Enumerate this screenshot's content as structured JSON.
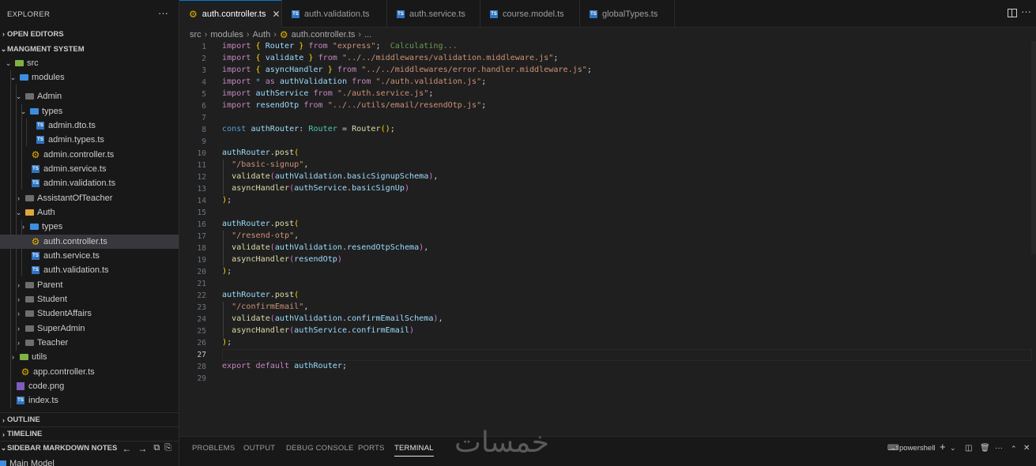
{
  "explorer": {
    "title": "EXPLORER",
    "more": "···",
    "open_editors": "OPEN EDITORS",
    "project": "MANGMENT SYSTEM",
    "outline": "OUTLINE",
    "timeline": "TIMELINE",
    "markdown_notes": "SIDEBAR MARKDOWN NOTES",
    "markdown_item": "Main Model",
    "tree": [
      {
        "label": "src"
      },
      {
        "label": "modules"
      },
      {
        "label": "Admin"
      },
      {
        "label": "types"
      },
      {
        "label": "admin.dto.ts"
      },
      {
        "label": "admin.types.ts"
      },
      {
        "label": "admin.controller.ts"
      },
      {
        "label": "admin.service.ts"
      },
      {
        "label": "admin.validation.ts"
      },
      {
        "label": "AssistantOfTeacher"
      },
      {
        "label": "Auth"
      },
      {
        "label": "types"
      },
      {
        "label": "auth.controller.ts"
      },
      {
        "label": "auth.service.ts"
      },
      {
        "label": "auth.validation.ts"
      },
      {
        "label": "Parent"
      },
      {
        "label": "Student"
      },
      {
        "label": "StudentAffairs"
      },
      {
        "label": "SuperAdmin"
      },
      {
        "label": "Teacher"
      },
      {
        "label": "utils"
      },
      {
        "label": "app.controller.ts"
      },
      {
        "label": "code.png"
      },
      {
        "label": "index.ts"
      }
    ]
  },
  "tabs": [
    {
      "label": "auth.controller.ts",
      "active": true
    },
    {
      "label": "auth.validation.ts"
    },
    {
      "label": "auth.service.ts"
    },
    {
      "label": "course.model.ts"
    },
    {
      "label": "globalTypes.ts"
    }
  ],
  "breadcrumb": [
    "src",
    "modules",
    "Auth",
    "auth.controller.ts",
    "..."
  ],
  "code": {
    "line_numbers": [
      "1",
      "2",
      "3",
      "4",
      "5",
      "6",
      "7",
      "8",
      "9",
      "10",
      "11",
      "12",
      "13",
      "14",
      "15",
      "16",
      "17",
      "18",
      "19",
      "20",
      "21",
      "22",
      "23",
      "24",
      "25",
      "26",
      "27",
      "28",
      "29"
    ],
    "calculating": "Calculating..."
  },
  "panel": {
    "tabs": [
      "PROBLEMS",
      "OUTPUT",
      "DEBUG CONSOLE",
      "PORTS",
      "TERMINAL"
    ],
    "terminal_name": "powershell",
    "watermark": "خمسات"
  },
  "colors": {
    "accent": "#0078d4",
    "background": "#1f1f1f",
    "sidebar": "#181818"
  }
}
